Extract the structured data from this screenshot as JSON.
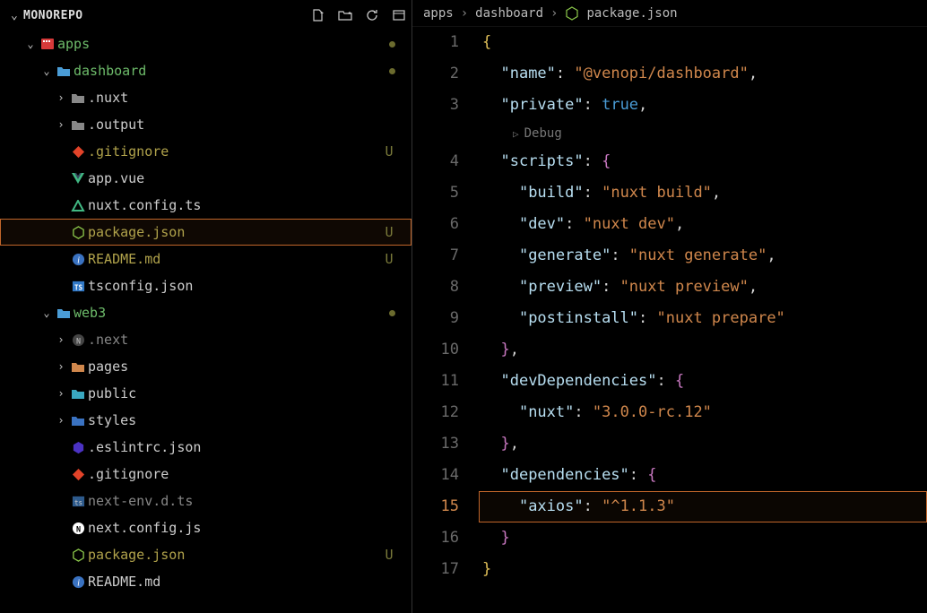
{
  "sidebar": {
    "title": "MONOREPO",
    "tree": [
      {
        "level": 1,
        "arrow": "down",
        "icon": "apps",
        "label": "apps",
        "cls": "green",
        "dot": true
      },
      {
        "level": 2,
        "arrow": "down",
        "icon": "folder-open",
        "label": "dashboard",
        "cls": "green",
        "dot": true
      },
      {
        "level": 3,
        "arrow": "right",
        "icon": "folder",
        "label": ".nuxt"
      },
      {
        "level": 3,
        "arrow": "right",
        "icon": "folder",
        "label": ".output"
      },
      {
        "level": 3,
        "icon": "git",
        "label": ".gitignore",
        "cls": "olive",
        "status": "U"
      },
      {
        "level": 3,
        "icon": "vue",
        "label": "app.vue"
      },
      {
        "level": 3,
        "icon": "nuxt",
        "label": "nuxt.config.ts"
      },
      {
        "level": 3,
        "icon": "node",
        "label": "package.json",
        "cls": "olive",
        "status": "U",
        "selected": true
      },
      {
        "level": 3,
        "icon": "info",
        "label": "README.md",
        "cls": "olive",
        "status": "U"
      },
      {
        "level": 3,
        "icon": "tsconfig",
        "label": "tsconfig.json"
      },
      {
        "level": 2,
        "arrow": "down",
        "icon": "folder-open",
        "label": "web3",
        "cls": "green",
        "dot": true
      },
      {
        "level": 3,
        "arrow": "right",
        "icon": "next-dir",
        "label": ".next",
        "cls": "dim"
      },
      {
        "level": 3,
        "arrow": "right",
        "icon": "folder-orange",
        "label": "pages"
      },
      {
        "level": 3,
        "arrow": "right",
        "icon": "folder-cyan",
        "label": "public"
      },
      {
        "level": 3,
        "arrow": "right",
        "icon": "folder-blue",
        "label": "styles"
      },
      {
        "level": 3,
        "icon": "eslint",
        "label": ".eslintrc.json"
      },
      {
        "level": 3,
        "icon": "git",
        "label": ".gitignore"
      },
      {
        "level": 3,
        "icon": "ts",
        "label": "next-env.d.ts",
        "cls": "dim"
      },
      {
        "level": 3,
        "icon": "next",
        "label": "next.config.js"
      },
      {
        "level": 3,
        "icon": "node",
        "label": "package.json",
        "cls": "olive",
        "status": "U"
      },
      {
        "level": 3,
        "icon": "info",
        "label": "README.md"
      }
    ]
  },
  "breadcrumbs": [
    "apps",
    "dashboard",
    "package.json"
  ],
  "hint": "Debug",
  "code": {
    "currentLine": 15,
    "lines": [
      {
        "n": 1,
        "tokens": [
          {
            "t": "{",
            "c": "t-brace"
          }
        ]
      },
      {
        "n": 2,
        "tokens": [
          {
            "t": "  ",
            "c": ""
          },
          {
            "t": "\"name\"",
            "c": "t-key"
          },
          {
            "t": ": ",
            "c": "t-punc"
          },
          {
            "t": "\"@venopi/dashboard\"",
            "c": "t-str"
          },
          {
            "t": ",",
            "c": "t-punc"
          }
        ]
      },
      {
        "n": 3,
        "tokens": [
          {
            "t": "  ",
            "c": ""
          },
          {
            "t": "\"private\"",
            "c": "t-key"
          },
          {
            "t": ": ",
            "c": "t-punc"
          },
          {
            "t": "true",
            "c": "t-bool"
          },
          {
            "t": ",",
            "c": "t-punc"
          }
        ]
      },
      {
        "hint": true
      },
      {
        "n": 4,
        "tokens": [
          {
            "t": "  ",
            "c": ""
          },
          {
            "t": "\"scripts\"",
            "c": "t-key"
          },
          {
            "t": ": ",
            "c": "t-punc"
          },
          {
            "t": "{",
            "c": "t-brace2"
          }
        ]
      },
      {
        "n": 5,
        "tokens": [
          {
            "t": "    ",
            "c": ""
          },
          {
            "t": "\"build\"",
            "c": "t-key"
          },
          {
            "t": ": ",
            "c": "t-punc"
          },
          {
            "t": "\"nuxt build\"",
            "c": "t-str"
          },
          {
            "t": ",",
            "c": "t-punc"
          }
        ]
      },
      {
        "n": 6,
        "tokens": [
          {
            "t": "    ",
            "c": ""
          },
          {
            "t": "\"dev\"",
            "c": "t-key"
          },
          {
            "t": ": ",
            "c": "t-punc"
          },
          {
            "t": "\"nuxt dev\"",
            "c": "t-str"
          },
          {
            "t": ",",
            "c": "t-punc"
          }
        ]
      },
      {
        "n": 7,
        "tokens": [
          {
            "t": "    ",
            "c": ""
          },
          {
            "t": "\"generate\"",
            "c": "t-key"
          },
          {
            "t": ": ",
            "c": "t-punc"
          },
          {
            "t": "\"nuxt generate\"",
            "c": "t-str"
          },
          {
            "t": ",",
            "c": "t-punc"
          }
        ]
      },
      {
        "n": 8,
        "tokens": [
          {
            "t": "    ",
            "c": ""
          },
          {
            "t": "\"preview\"",
            "c": "t-key"
          },
          {
            "t": ": ",
            "c": "t-punc"
          },
          {
            "t": "\"nuxt preview\"",
            "c": "t-str"
          },
          {
            "t": ",",
            "c": "t-punc"
          }
        ]
      },
      {
        "n": 9,
        "tokens": [
          {
            "t": "    ",
            "c": ""
          },
          {
            "t": "\"postinstall\"",
            "c": "t-key"
          },
          {
            "t": ": ",
            "c": "t-punc"
          },
          {
            "t": "\"nuxt prepare\"",
            "c": "t-str"
          }
        ]
      },
      {
        "n": 10,
        "tokens": [
          {
            "t": "  ",
            "c": ""
          },
          {
            "t": "}",
            "c": "t-brace2"
          },
          {
            "t": ",",
            "c": "t-punc"
          }
        ]
      },
      {
        "n": 11,
        "tokens": [
          {
            "t": "  ",
            "c": ""
          },
          {
            "t": "\"devDependencies\"",
            "c": "t-key"
          },
          {
            "t": ": ",
            "c": "t-punc"
          },
          {
            "t": "{",
            "c": "t-brace2"
          }
        ]
      },
      {
        "n": 12,
        "tokens": [
          {
            "t": "    ",
            "c": ""
          },
          {
            "t": "\"nuxt\"",
            "c": "t-key"
          },
          {
            "t": ": ",
            "c": "t-punc"
          },
          {
            "t": "\"3.0.0-rc.12\"",
            "c": "t-str"
          }
        ]
      },
      {
        "n": 13,
        "tokens": [
          {
            "t": "  ",
            "c": ""
          },
          {
            "t": "}",
            "c": "t-brace2"
          },
          {
            "t": ",",
            "c": "t-punc"
          }
        ]
      },
      {
        "n": 14,
        "tokens": [
          {
            "t": "  ",
            "c": ""
          },
          {
            "t": "\"dependencies\"",
            "c": "t-key"
          },
          {
            "t": ": ",
            "c": "t-punc"
          },
          {
            "t": "{",
            "c": "t-brace2"
          }
        ]
      },
      {
        "n": 15,
        "tokens": [
          {
            "t": "    ",
            "c": ""
          },
          {
            "t": "\"axios\"",
            "c": "t-key"
          },
          {
            "t": ": ",
            "c": "t-punc"
          },
          {
            "t": "\"^1.1.3\"",
            "c": "t-str"
          }
        ]
      },
      {
        "n": 16,
        "tokens": [
          {
            "t": "  ",
            "c": ""
          },
          {
            "t": "}",
            "c": "t-brace2"
          }
        ]
      },
      {
        "n": 17,
        "tokens": [
          {
            "t": "}",
            "c": "t-brace"
          }
        ]
      }
    ]
  }
}
